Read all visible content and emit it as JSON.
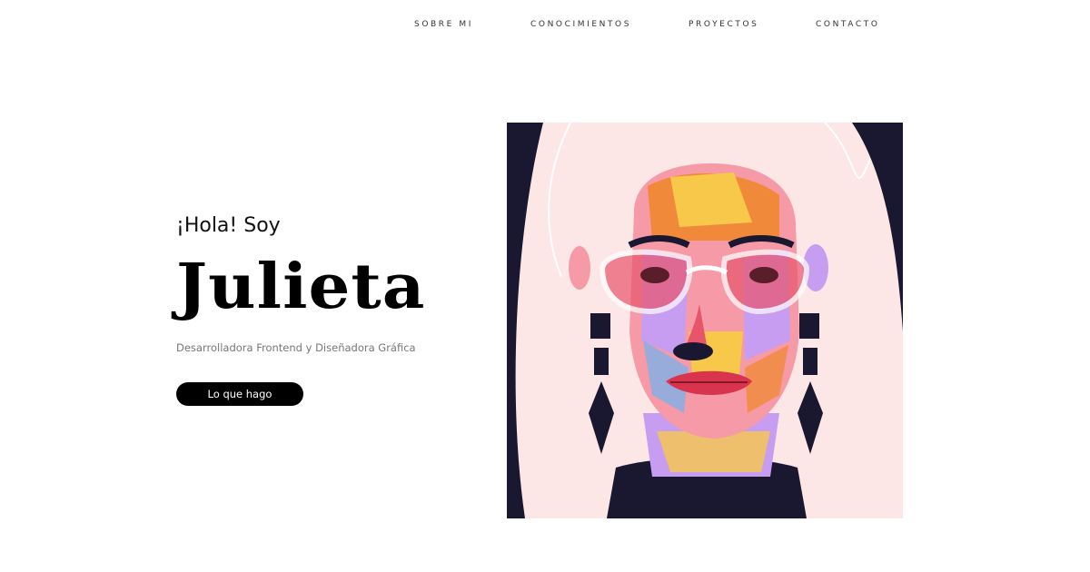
{
  "nav": {
    "items": [
      {
        "label": "SOBRE MI"
      },
      {
        "label": "CONOCIMIENTOS"
      },
      {
        "label": "PROYECTOS"
      },
      {
        "label": "CONTACTO"
      }
    ]
  },
  "hero": {
    "greeting": "¡Hola! Soy",
    "name": "Julieta",
    "subtitle": "Desarrolladora Frontend y Diseñadora Gráfica",
    "cta_label": "Lo que hago"
  },
  "portrait": {
    "background_color": "#1a1730",
    "hair_color": "#fde6e6",
    "colors": [
      "#f59aa6",
      "#f7c84a",
      "#c79df2",
      "#f08a3a",
      "#7fb0e8",
      "#e8556b"
    ]
  }
}
